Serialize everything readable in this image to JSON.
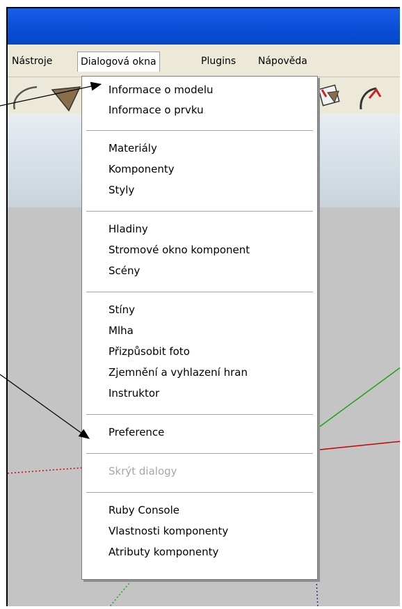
{
  "menubar": {
    "items": [
      {
        "label": "Nástroje"
      },
      {
        "label": "Dialogová okna"
      },
      {
        "label": "Plugins"
      },
      {
        "label": "Nápověda"
      }
    ]
  },
  "dropdown": {
    "items": [
      {
        "label": "Informace o modelu"
      },
      {
        "label": "Informace o prvku"
      },
      {
        "label": "Materiály"
      },
      {
        "label": "Komponenty"
      },
      {
        "label": "Styly"
      },
      {
        "label": "Hladiny"
      },
      {
        "label": "Stromové okno komponent"
      },
      {
        "label": "Scény"
      },
      {
        "label": "Stíny"
      },
      {
        "label": "Mlha"
      },
      {
        "label": "Přizpůsobit foto"
      },
      {
        "label": "Zjemnění a vyhlazení hran"
      },
      {
        "label": "Instruktor"
      },
      {
        "label": "Preference"
      },
      {
        "label": "Skrýt dialogy",
        "disabled": true
      },
      {
        "label": "Ruby Console"
      },
      {
        "label": "Vlastnosti komponenty"
      },
      {
        "label": "Atributy komponenty"
      }
    ]
  },
  "colors": {
    "titlebar": "#0a4fd8",
    "menubar": "#ece9d8",
    "sky": "#d5dde5",
    "ground": "#c4c4c4",
    "axis_red": "#cc0000",
    "axis_green": "#1aa31a",
    "axis_blue": "#2a2aa0"
  },
  "icons": [
    "arc-tool-icon",
    "triangle-tool-icon",
    "position-camera-icon",
    "walk-tool-icon"
  ]
}
